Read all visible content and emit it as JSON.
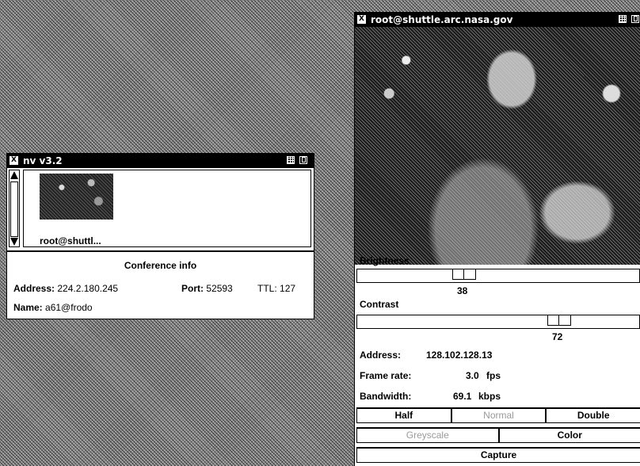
{
  "nv_window": {
    "title": "nv v3.2",
    "thumbnail_label": "root@shuttl...",
    "conference_title": "Conference info",
    "address_label": "Address:",
    "address_value": "224.2.180.245",
    "port_label": "Port:",
    "port_value": "52593",
    "ttl_label": "TTL:",
    "ttl_value": "127",
    "name_label": "Name:",
    "name_value": "a61@frodo"
  },
  "video_window": {
    "title": "root@shuttle.arc.nasa.gov",
    "brightness_label": "Brightness",
    "brightness_value": "38",
    "brightness_level": 0.38,
    "contrast_label": "Contrast",
    "contrast_value": "72",
    "contrast_level": 0.72,
    "address_label": "Address:",
    "address_value": "128.102.128.13",
    "framerate_label": "Frame rate:",
    "framerate_value": "3.0",
    "framerate_unit": "fps",
    "bandwidth_label": "Bandwidth:",
    "bandwidth_value": "69.1",
    "bandwidth_unit": "kbps",
    "size_buttons": [
      "Half",
      "Normal",
      "Double"
    ],
    "color_buttons": [
      "Greyscale",
      "Color"
    ],
    "capture_label": "Capture"
  },
  "icons": [
    "x-menu-icon",
    "iconify-icon",
    "maximize-icon"
  ]
}
